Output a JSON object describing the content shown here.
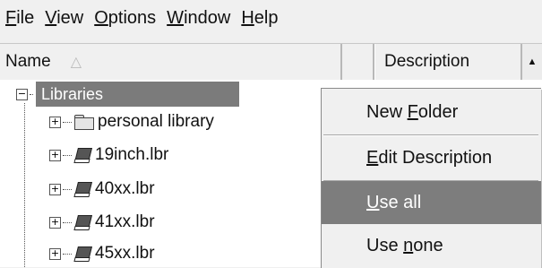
{
  "menubar": [
    {
      "pre": "",
      "key": "F",
      "post": "ile"
    },
    {
      "pre": "",
      "key": "V",
      "post": "iew"
    },
    {
      "pre": "",
      "key": "O",
      "post": "ptions"
    },
    {
      "pre": "",
      "key": "W",
      "post": "indow"
    },
    {
      "pre": "",
      "key": "H",
      "post": "elp"
    }
  ],
  "columns": {
    "name": "Name",
    "sort_indicator": "△",
    "description": "Description"
  },
  "tree": {
    "root": {
      "label": "Libraries",
      "expander": "−"
    },
    "children": [
      {
        "label": "personal library",
        "icon": "folder-icon",
        "expander": "+"
      },
      {
        "label": "19inch.lbr",
        "icon": "library-book-icon",
        "expander": "+"
      },
      {
        "label": "40xx.lbr",
        "icon": "library-book-icon",
        "expander": "+"
      },
      {
        "label": "41xx.lbr",
        "icon": "library-book-icon",
        "expander": "+"
      },
      {
        "label": "45xx.lbr",
        "icon": "library-book-icon",
        "expander": "+"
      }
    ]
  },
  "context_menu": [
    {
      "pre": "New ",
      "key": "F",
      "post": "older",
      "selected": false
    },
    {
      "pre": "",
      "key": "E",
      "post": "dit Description",
      "selected": false
    },
    {
      "pre": "",
      "key": "U",
      "post": "se all",
      "selected": true
    },
    {
      "pre": "Use ",
      "key": "n",
      "post": "one",
      "selected": false
    }
  ],
  "colors": {
    "selection": "#7d7d7d",
    "background": "#f0f0f0"
  }
}
